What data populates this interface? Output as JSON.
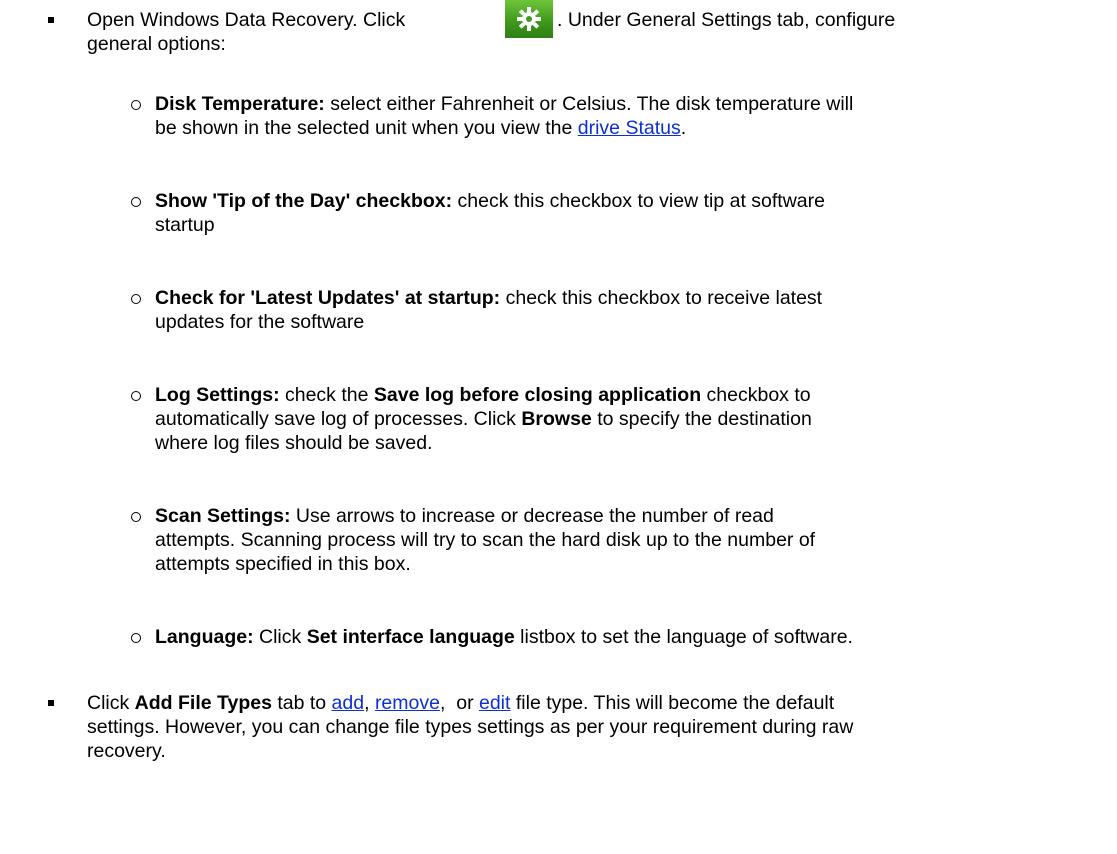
{
  "item1": {
    "pre": "Open Windows Data Recovery. Click",
    "post": ". Under General Settings tab, configure",
    "line2": "general options:",
    "icon": "settings-gear-icon",
    "icon_color": "#4aa523"
  },
  "options": [
    {
      "label": "Disk Temperature:",
      "t1": " select either Fahrenheit or Celsius. The disk temperature will",
      "t2": "be shown in the selected unit when you view the ",
      "link": "drive Status",
      "t3": "."
    },
    {
      "label": "Show 'Tip of the Day' checkbox:",
      "t1": " check this checkbox to view tip at software",
      "t2": "startup"
    },
    {
      "label": "Check for 'Latest Updates' at startup:",
      "t1": " check this checkbox to receive latest",
      "t2": "updates for the software"
    },
    {
      "label": "Log Settings:",
      "t1": " check the ",
      "b1": "Save log before closing application",
      "t1b": " checkbox to",
      "t2": "automatically save log of processes. Click ",
      "b2": "Browse",
      "t2b": " to specify the destination",
      "t3": "where log files should be saved."
    },
    {
      "label": "Scan Settings:",
      "t1": " Use arrows to increase or decrease the number of read",
      "t2": "attempts. Scanning process will try to scan the hard disk up to the number of",
      "t3": "attempts specified in this box."
    },
    {
      "label": "Language:",
      "t1": " Click ",
      "b1": "Set interface language",
      "t1b": " listbox to set the language of software."
    }
  ],
  "item2": {
    "pre": "Click ",
    "bold": "Add File Types",
    "mid": " tab to ",
    "link_add": "add",
    "comma1": ", ",
    "link_remove": "remove",
    "comma2": ",  or ",
    "link_edit": "edit",
    "post": " file type. This will become the default",
    "line2": "settings. However, you can change file types settings as per your requirement during raw",
    "line3": "recovery."
  }
}
